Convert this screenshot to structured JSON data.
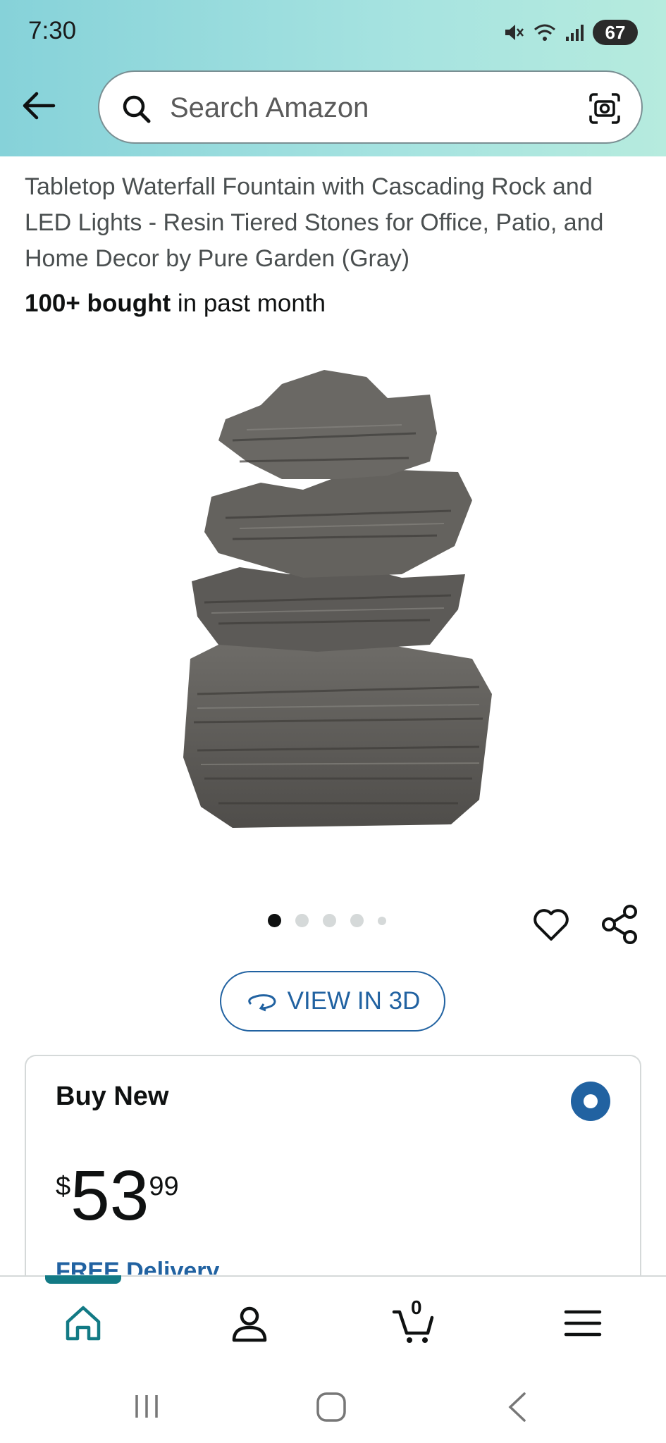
{
  "status_bar": {
    "time": "7:30",
    "battery": "67"
  },
  "search": {
    "placeholder": "Search Amazon"
  },
  "product": {
    "title": "Tabletop Waterfall Fountain with Cascading Rock and LED Lights - Resin Tiered Stones for Office, Patio, and Home Decor by Pure Garden (Gray)",
    "bought_bold": "100+ bought",
    "bought_rest": " in past month",
    "image_count": 5,
    "active_image": 1
  },
  "view3d": {
    "label": "VIEW IN 3D"
  },
  "buy_box": {
    "title": "Buy New",
    "price_symbol": "$",
    "price_whole": "53",
    "price_fraction": "99",
    "delivery_partial": "FREE Delivery"
  },
  "bottom_nav": {
    "cart_count": "0",
    "active": "home"
  },
  "icons": {
    "back": "back-arrow-icon",
    "search": "search-icon",
    "camera": "camera-scan-icon",
    "heart": "heart-icon",
    "share": "share-icon",
    "home": "home-icon",
    "account": "account-icon",
    "cart": "cart-icon",
    "menu": "menu-icon"
  },
  "colors": {
    "accent": "#2162a1",
    "nav_active": "#127a85",
    "header_gradient_start": "#86d2d9",
    "header_gradient_end": "#b6ebde"
  }
}
